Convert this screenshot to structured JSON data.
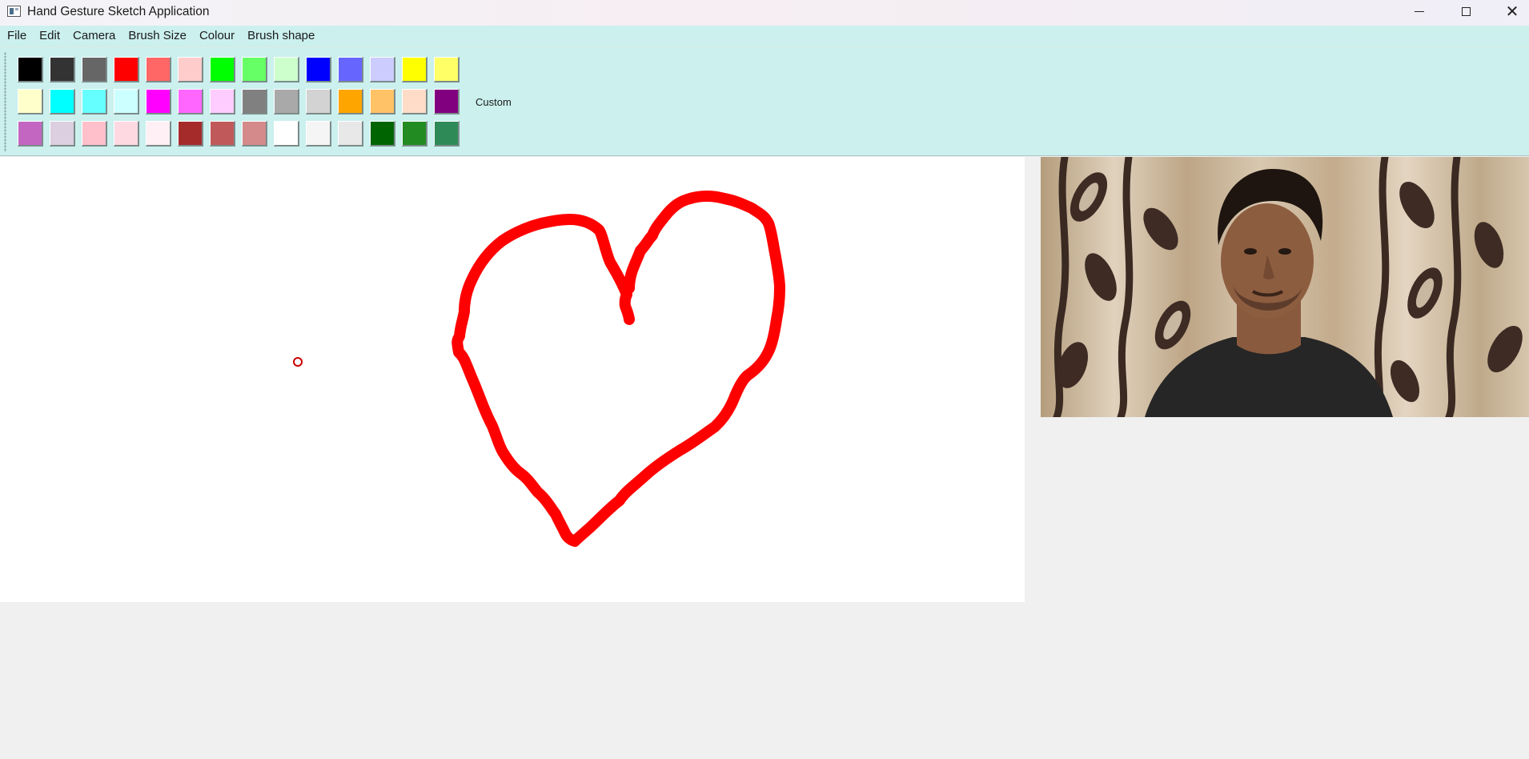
{
  "window": {
    "title": "Hand Gesture Sketch Application",
    "icon": "app-window-icon"
  },
  "window_controls": {
    "minimize_icon": "minimize-icon",
    "maximize_icon": "maximize-icon",
    "close_icon": "close-icon"
  },
  "menu": {
    "items": [
      "File",
      "Edit",
      "Camera",
      "Brush Size",
      "Colour",
      "Brush shape"
    ]
  },
  "palette": {
    "rows": [
      [
        "#000000",
        "#333333",
        "#666666",
        "#ff0000",
        "#ff6666",
        "#ffcccc",
        "#00ff00",
        "#66ff66",
        "#ccffcc",
        "#0000ff",
        "#6666ff",
        "#ccccff",
        "#ffff00",
        "#ffff66"
      ],
      [
        "#ffffcc",
        "#00ffff",
        "#66ffff",
        "#ccffff",
        "#ff00ff",
        "#ff66ff",
        "#ffccff",
        "#808080",
        "#a9a9a9",
        "#d3d3d3",
        "#ffa500",
        "#ffc266",
        "#ffdcc8",
        "#800080"
      ],
      [
        "#c266c2",
        "#dccfe0",
        "#ffc0cb",
        "#ffd9e2",
        "#fff0f5",
        "#a52a2a",
        "#c05a5a",
        "#d48a8a",
        "#ffffff",
        "#f5f5f5",
        "#e8e8e8",
        "#006400",
        "#228b22",
        "#2e8b57"
      ]
    ],
    "custom_label": "Custom"
  },
  "canvas": {
    "background": "#ffffff",
    "stroke_color": "#ff0000",
    "cursor_color": "#cc0000"
  },
  "camera": {
    "label": "camera-feed-image"
  }
}
